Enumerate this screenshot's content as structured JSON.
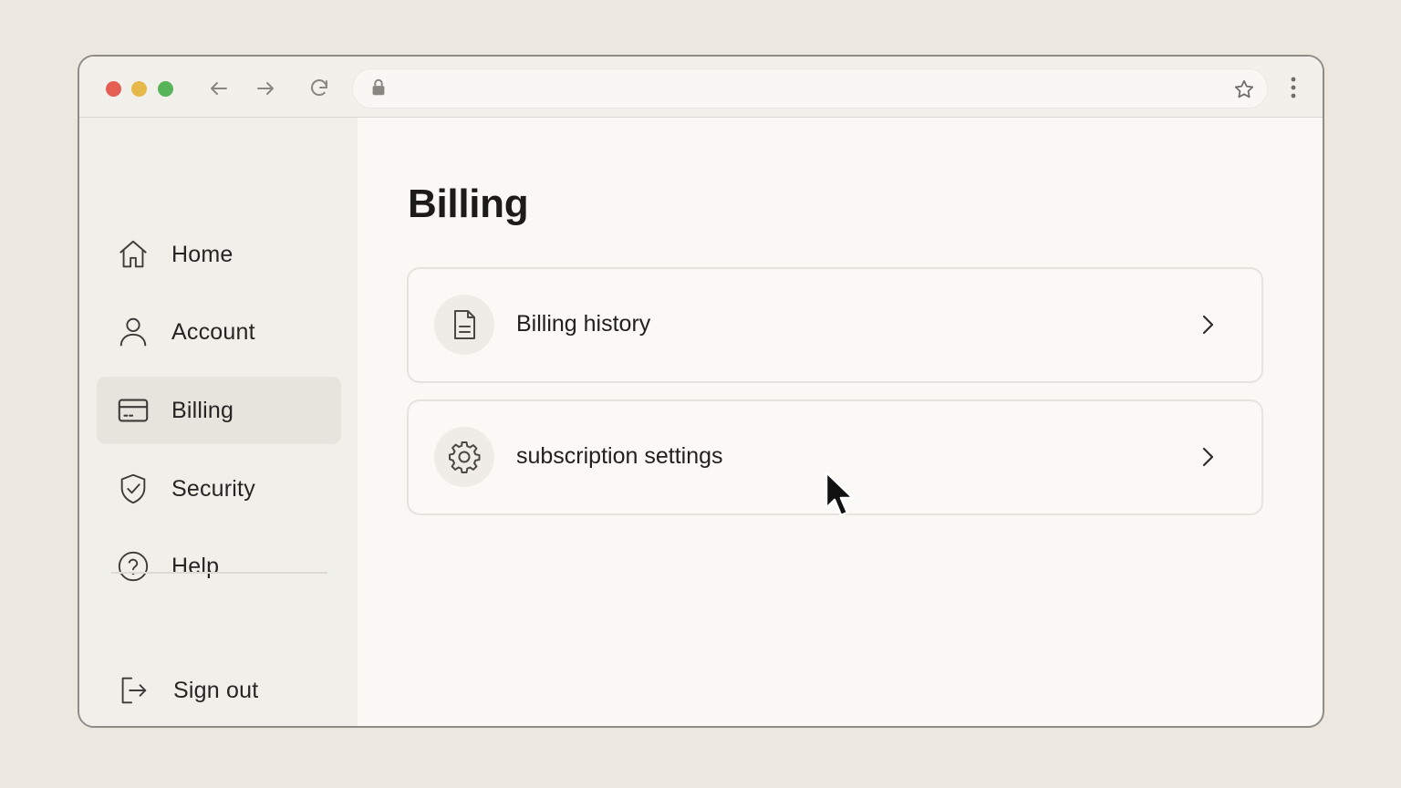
{
  "browser": {
    "traffic_lights": [
      {
        "name": "close",
        "color": "#e45e54"
      },
      {
        "name": "minimize",
        "color": "#e6b84a"
      },
      {
        "name": "maximize",
        "color": "#58b458"
      }
    ],
    "icons": [
      "back-arrow-icon",
      "forward-arrow-icon",
      "reload-icon",
      "lock-icon",
      "star-icon",
      "kebab-menu-icon"
    ],
    "address_value": ""
  },
  "sidebar": {
    "items": [
      {
        "label": "Home",
        "icon": "home-icon"
      },
      {
        "label": "Account",
        "icon": "user-icon"
      },
      {
        "label": "Billing",
        "icon": "credit-card-icon",
        "active": true
      },
      {
        "label": "Security",
        "icon": "shield-check-icon"
      },
      {
        "label": "Help",
        "icon": "help-circle-icon"
      }
    ],
    "signout": {
      "label": "Sign out",
      "icon": "sign-out-icon"
    }
  },
  "main": {
    "title": "Billing",
    "cards": [
      {
        "label": "Billing history",
        "icon": "document-icon"
      },
      {
        "label": "subscription settings",
        "icon": "gear-icon"
      }
    ]
  },
  "colors": {
    "background": "#ece8df",
    "sidebar": "#f1efea",
    "active_item": "#e7e3dd",
    "content": "#f9f8f5"
  }
}
